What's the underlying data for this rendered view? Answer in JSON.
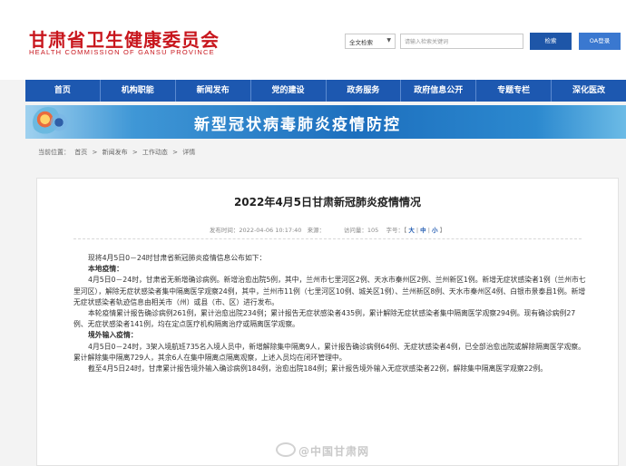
{
  "header": {
    "logo_cn": "甘肃省卫生健康委员会",
    "logo_en": "HEALTH COMMISSION OF GANSU PROVINCE",
    "search_scope": "全文检索",
    "search_placeholder": "请输入检索关键词",
    "search_button": "检索",
    "oa_button": "OA登录"
  },
  "nav": {
    "items": [
      "首页",
      "机构职能",
      "新闻发布",
      "党的建设",
      "政务服务",
      "政府信息公开",
      "专题专栏",
      "深化医改"
    ]
  },
  "banner": {
    "title": "新型冠状病毒肺炎疫情防控"
  },
  "breadcrumb": {
    "label": "当前位置：",
    "items": [
      "首页",
      "新闻发布",
      "工作动态",
      "详情"
    ],
    "separator": ">"
  },
  "article": {
    "title": "2022年4月5日甘肃新冠肺炎疫情情况",
    "publish_label": "发布时间：",
    "publish_time": "2022-04-06 10:17:40",
    "source_label": "来源：",
    "visits_label": "访问量：",
    "visits": "105",
    "font_label": "字号：",
    "font_large": "大",
    "font_medium": "中",
    "font_small": "小",
    "intro": "现将4月5日0－24时甘肃省新冠肺炎疫情信息公布如下：",
    "local_heading": "本地疫情：",
    "local_p1": "4月5日0－24时，甘肃省无新增确诊病例。新增治愈出院5例，其中，兰州市七里河区2例、天水市秦州区2例、兰州新区1例。新增无症状感染者1例（兰州市七里河区），解除无症状感染者集中隔离医学观察24例，其中，兰州市11例（七里河区10例、城关区1例）、兰州新区8例、天水市秦州区4例、白银市景泰县1例。新增无症状感染者轨迹信息由相关市（州）或县（市、区）进行发布。",
    "local_p2": "本轮疫情累计报告确诊病例261例，累计治愈出院234例；累计报告无症状感染者435例，累计解除无症状感染者集中隔离医学观察294例。现有确诊病例27例、无症状感染者141例，均在定点医疗机构隔离治疗或隔离医学观察。",
    "imported_heading": "境外输入疫情：",
    "imported_p1": "4月5日0－24时，3架入境航班735名入境人员中，新增解除集中隔离9人，累计报告确诊病例64例、无症状感染者4例，已全部治愈出院或解除隔离医学观察。累计解除集中隔离729人，其余6人在集中隔离点隔离观察，上述入员均在闭环管理中。",
    "imported_p2": "截至4月5日24时，甘肃累计报告境外输入确诊病例184例，治愈出院184例；累计报告境外输入无症状感染者22例，解除集中隔离医学观察22例。"
  },
  "watermark": {
    "text": "@中国甘肃网"
  }
}
